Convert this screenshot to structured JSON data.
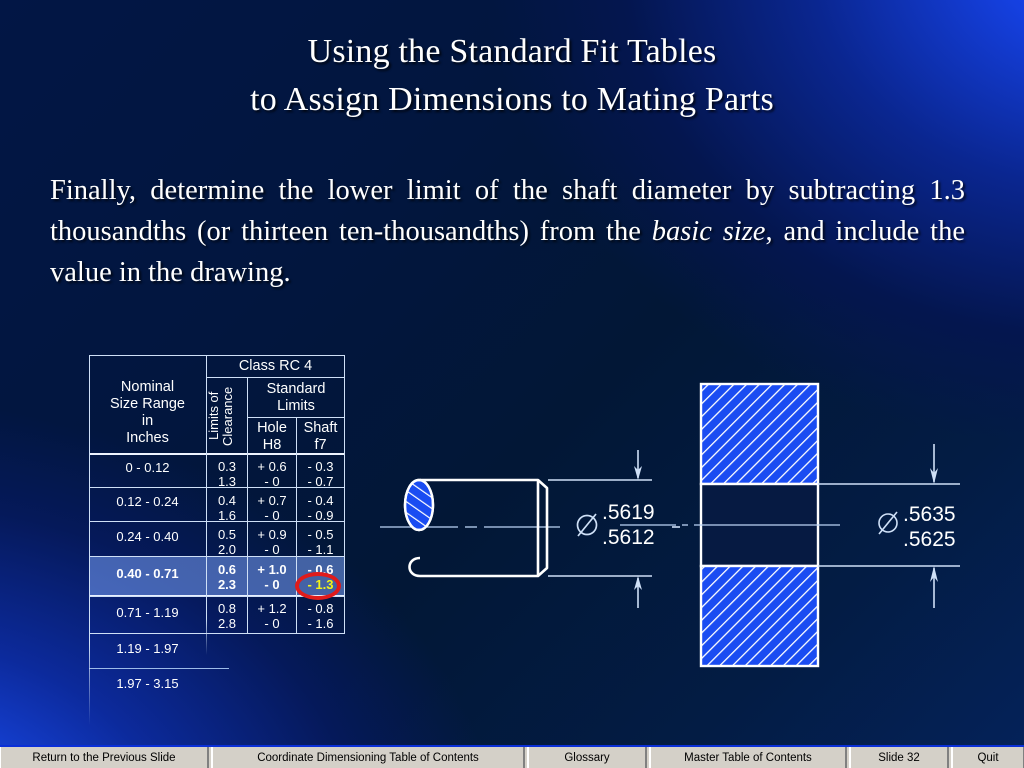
{
  "slide": {
    "title_line1": "Using the Standard Fit Tables",
    "title_line2": "to Assign Dimensions to Mating Parts",
    "body_part1": "Finally, determine the lower limit of the shaft diameter by subtracting 1.3 thousandths (or thirteen ten-thousandths) from the ",
    "body_italic": "basic size",
    "body_part2": ", and include the value in the drawing."
  },
  "table": {
    "col_nominal": "Nominal\nSize Range\nin\nInches",
    "col_class": "Class RC 4",
    "col_limits_clearance": "Limits of\nClearance",
    "col_standard_limits": "Standard\nLimits",
    "col_hole": "Hole\nH8",
    "col_shaft": "Shaft\nf7",
    "rows": [
      {
        "nominal": "0      - 0.12",
        "clearance_a": "0.3",
        "clearance_b": "1.3",
        "hole_a": "+ 0.6",
        "hole_b": "- 0",
        "shaft_a": "- 0.3",
        "shaft_b": "- 0.7",
        "highlight": false
      },
      {
        "nominal": "0.12 - 0.24",
        "clearance_a": "0.4",
        "clearance_b": "1.6",
        "hole_a": "+ 0.7",
        "hole_b": "- 0",
        "shaft_a": "- 0.4",
        "shaft_b": "- 0.9",
        "highlight": false
      },
      {
        "nominal": "0.24 - 0.40",
        "clearance_a": "0.5",
        "clearance_b": "2.0",
        "hole_a": "+ 0.9",
        "hole_b": "- 0",
        "shaft_a": "- 0.5",
        "shaft_b": "- 1.1",
        "highlight": false
      },
      {
        "nominal": "0.40 - 0.71",
        "clearance_a": "0.6",
        "clearance_b": "2.3",
        "hole_a": "+ 1.0",
        "hole_b": "- 0",
        "shaft_a": "- 0.6",
        "shaft_b": "- 1.3",
        "highlight": true
      },
      {
        "nominal": "0.71 - 1.19",
        "clearance_a": "0.8",
        "clearance_b": "2.8",
        "hole_a": "+ 1.2",
        "hole_b": "- 0",
        "shaft_a": "- 0.8",
        "shaft_b": "- 1.6",
        "highlight": false
      },
      {
        "nominal": "1.19 - 1.97",
        "clearance_a": "",
        "clearance_b": "",
        "hole_a": "",
        "hole_b": "",
        "shaft_a": "",
        "shaft_b": "",
        "highlight": false
      },
      {
        "nominal": "1.97 - 3.15",
        "clearance_a": "",
        "clearance_b": "",
        "hole_a": "",
        "hole_b": "",
        "shaft_a": "",
        "shaft_b": "",
        "highlight": false
      }
    ],
    "highlight_color": "#78a0f5",
    "annotation_circle_color": "#e01b1b",
    "annotation_value_color": "#f2f318"
  },
  "drawings": {
    "shaft": {
      "diameter_symbol": "⌀",
      "upper_limit": ".5619",
      "lower_limit": ".5612",
      "lower_limit_color": "#f2f318"
    },
    "hole": {
      "diameter_symbol": "⌀",
      "upper_limit": ".5635",
      "lower_limit": ".5625"
    }
  },
  "navbar": {
    "buttons": [
      "Return to the Previous Slide",
      "Coordinate Dimensioning Table of Contents",
      "Glossary",
      "Master Table of Contents",
      "Slide 32",
      "Quit"
    ]
  }
}
